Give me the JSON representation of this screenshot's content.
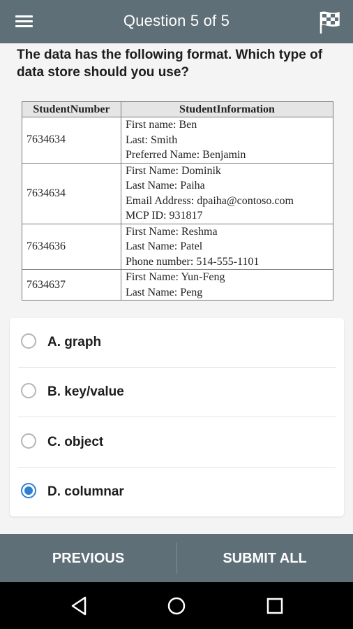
{
  "header": {
    "title": "Question 5 of 5"
  },
  "question": {
    "text": "The data has the following format. Which type of data store should you use?"
  },
  "table": {
    "headers": [
      "StudentNumber",
      "StudentInformation"
    ],
    "rows": [
      {
        "number": "7634634",
        "lines": [
          "First name: Ben",
          "Last: Smith",
          "Preferred Name: Benjamin"
        ]
      },
      {
        "number": "7634634",
        "lines": [
          "First Name: Dominik",
          "Last Name: Paiha",
          "Email Address: dpaiha@contoso.com",
          "MCP ID: 931817"
        ]
      },
      {
        "number": "7634636",
        "lines": [
          "First Name: Reshma",
          "Last Name: Patel",
          "Phone number: 514-555-1101"
        ]
      },
      {
        "number": "7634637",
        "lines": [
          "First Name: Yun-Feng",
          "Last Name: Peng"
        ]
      }
    ]
  },
  "options": [
    {
      "label": "A. graph",
      "selected": false
    },
    {
      "label": "B. key/value",
      "selected": false
    },
    {
      "label": "C. object",
      "selected": false
    },
    {
      "label": "D. columnar",
      "selected": true
    }
  ],
  "actions": {
    "previous_label": "PREVIOUS",
    "submit_label": "SUBMIT ALL"
  },
  "icons": {
    "menu": "hamburger-menu-icon",
    "flag": "checkered-flag-icon",
    "back": "triangle-back-icon",
    "home": "circle-home-icon",
    "recents": "square-recents-icon"
  },
  "colors": {
    "bar": "#5f6f78",
    "accent": "#2f7fd1",
    "background": "#f4f4f4"
  }
}
